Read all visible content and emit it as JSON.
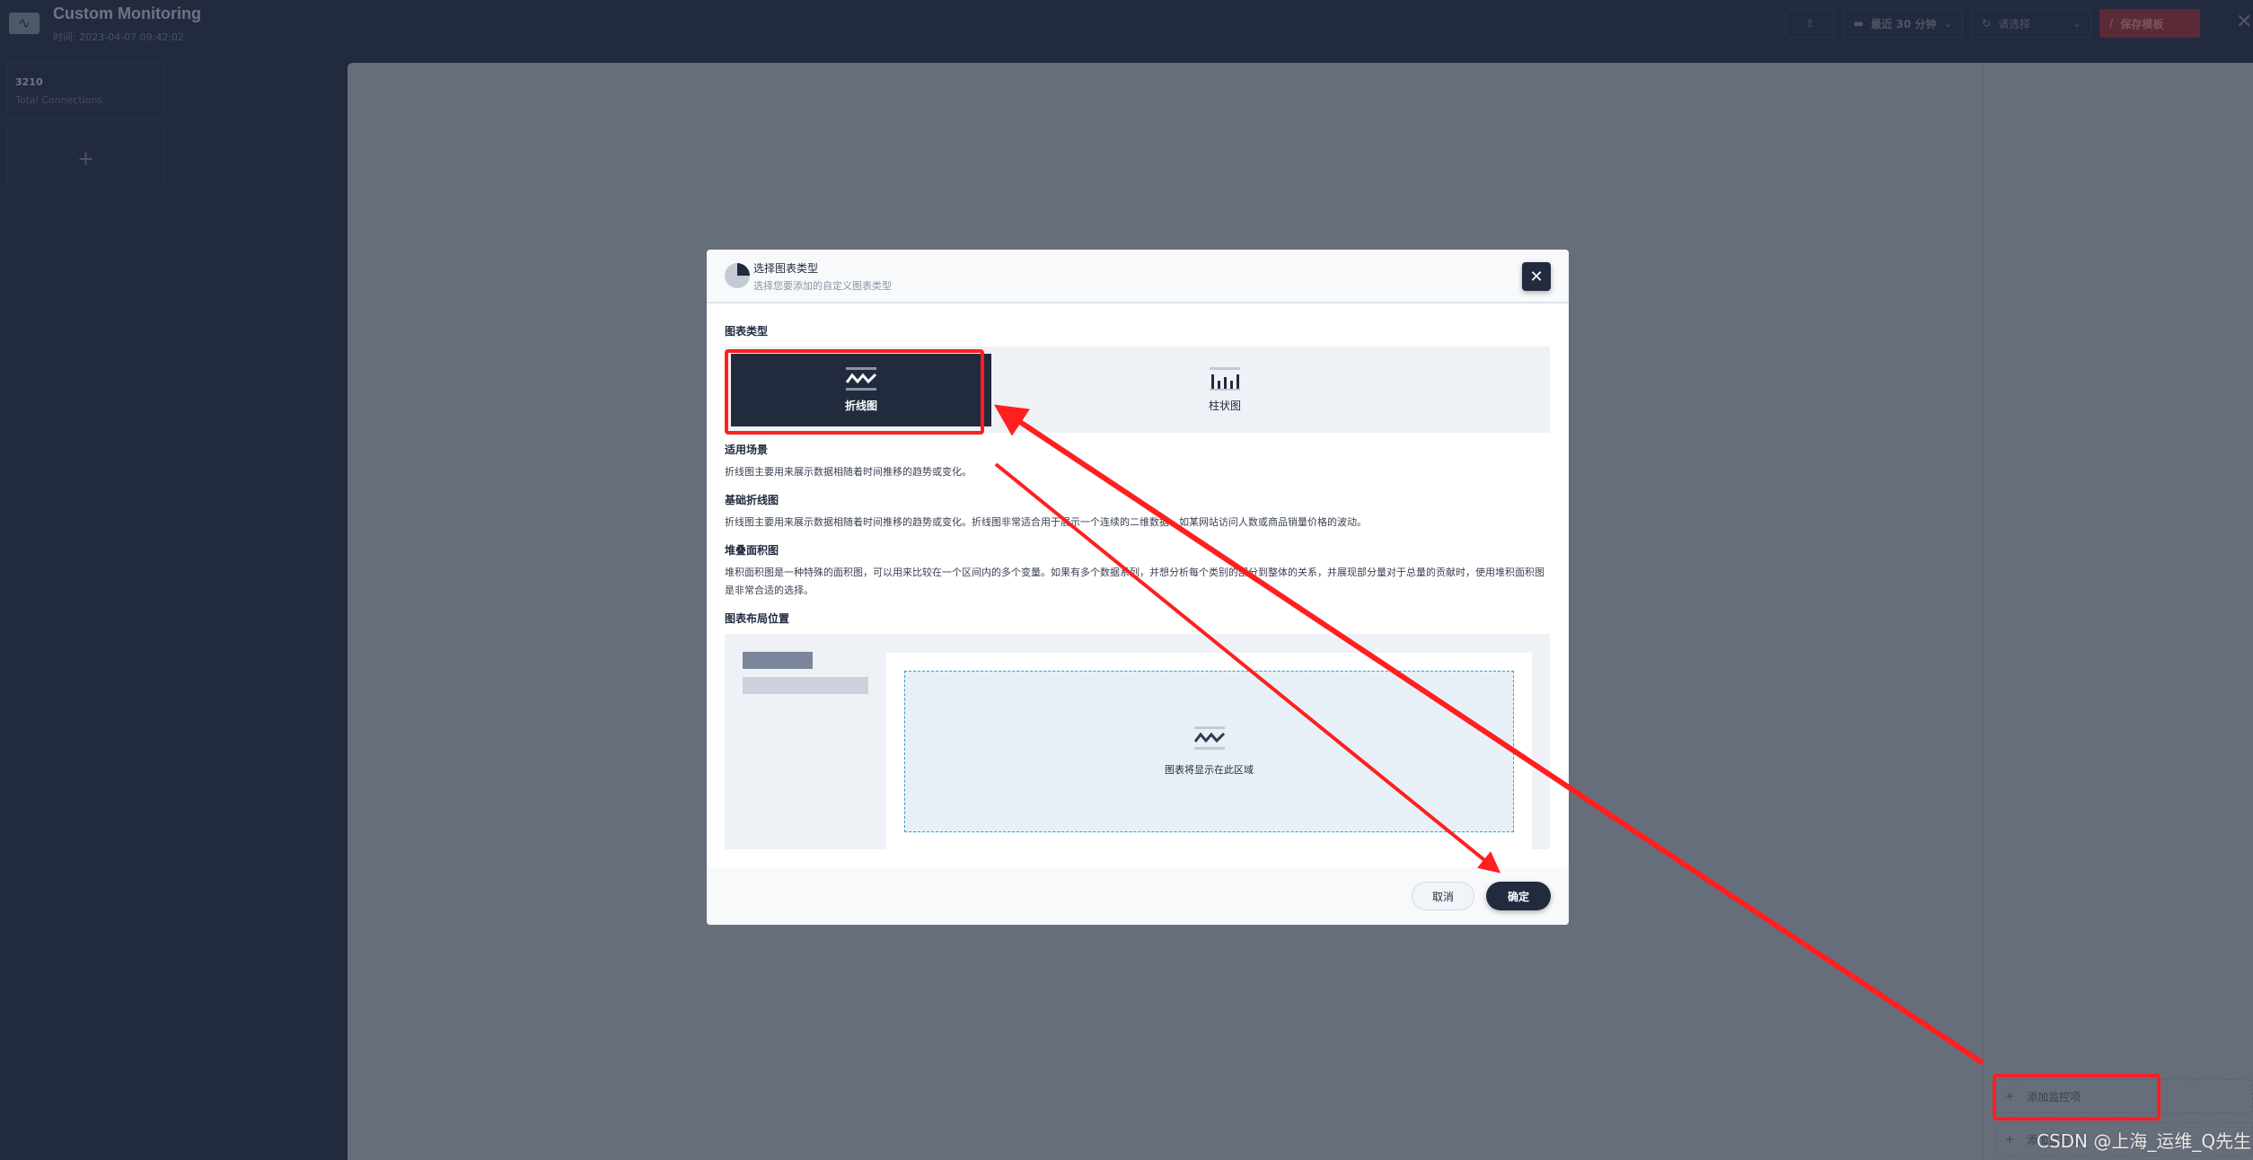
{
  "header": {
    "title": "Custom Monitoring",
    "time": "时间: 2023-04-07 09:42:02",
    "time_range": "最近 30 分钟",
    "refresh_placeholder": "请选择",
    "save_label": "保存模板"
  },
  "sidebar": {
    "cards": [
      {
        "value": "3210",
        "label": "Total Connections"
      }
    ],
    "add_symbol": "+"
  },
  "right_panel": {
    "items": [
      {
        "label": "添加监控项"
      },
      {
        "label": "添加监控项"
      }
    ]
  },
  "modal": {
    "title": "选择图表类型",
    "subtitle": "选择您要添加的自定义图表类型",
    "chart_type_label": "图表类型",
    "types": [
      {
        "label": "折线图",
        "icon": "line-chart-icon",
        "selected": true
      },
      {
        "label": "柱状图",
        "icon": "bar-chart-icon",
        "selected": false
      }
    ],
    "scene_title": "适用场景",
    "scene_text": "折线图主要用来展示数据相随着时间推移的趋势或变化。",
    "basic_title": "基础折线图",
    "basic_text": "折线图主要用来展示数据相随着时间推移的趋势或变化。折线图非常适合用于展示一个连续的二维数据，如某网站访问人数或商品销量价格的波动。",
    "stack_title": "堆叠面积图",
    "stack_text": "堆积面积图是一种特殊的面积图，可以用来比较在一个区间内的多个变量。如果有多个数据系列，并想分析每个类别的部分到整体的关系，并展现部分量对于总量的贡献时，使用堆积面积图是非常合适的选择。",
    "layout_title": "图表布局位置",
    "placeholder_text": "图表将显示在此区域",
    "cancel_label": "取消",
    "ok_label": "确定"
  },
  "annotation_color": "#ff1f1f",
  "watermark": "CSDN @上海_运维_Q先生"
}
